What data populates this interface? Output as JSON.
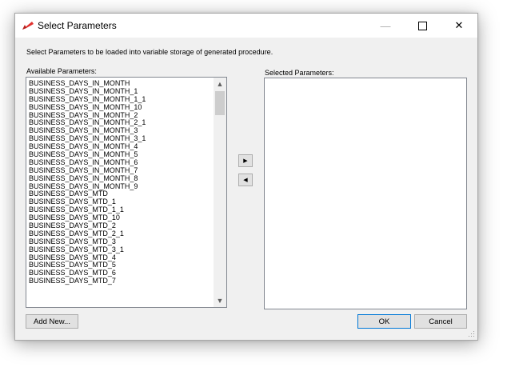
{
  "window": {
    "title": "Select Parameters",
    "minimize_glyph": "—",
    "close_glyph": "✕"
  },
  "instruction": "Select Parameters to be loaded into variable storage of generated procedure.",
  "available": {
    "label": "Available Parameters:",
    "items": [
      "BUSINESS_DAYS_IN_MONTH",
      "BUSINESS_DAYS_IN_MONTH_1",
      "BUSINESS_DAYS_IN_MONTH_1_1",
      "BUSINESS_DAYS_IN_MONTH_10",
      "BUSINESS_DAYS_IN_MONTH_2",
      "BUSINESS_DAYS_IN_MONTH_2_1",
      "BUSINESS_DAYS_IN_MONTH_3",
      "BUSINESS_DAYS_IN_MONTH_3_1",
      "BUSINESS_DAYS_IN_MONTH_4",
      "BUSINESS_DAYS_IN_MONTH_5",
      "BUSINESS_DAYS_IN_MONTH_6",
      "BUSINESS_DAYS_IN_MONTH_7",
      "BUSINESS_DAYS_IN_MONTH_8",
      "BUSINESS_DAYS_IN_MONTH_9",
      "BUSINESS_DAYS_MTD",
      "BUSINESS_DAYS_MTD_1",
      "BUSINESS_DAYS_MTD_1_1",
      "BUSINESS_DAYS_MTD_10",
      "BUSINESS_DAYS_MTD_2",
      "BUSINESS_DAYS_MTD_2_1",
      "BUSINESS_DAYS_MTD_3",
      "BUSINESS_DAYS_MTD_3_1",
      "BUSINESS_DAYS_MTD_4",
      "BUSINESS_DAYS_MTD_5",
      "BUSINESS_DAYS_MTD_6",
      "BUSINESS_DAYS_MTD_7"
    ],
    "scroll_up_glyph": "▲",
    "scroll_down_glyph": "▼"
  },
  "selected": {
    "label": "Selected Parameters:",
    "items": []
  },
  "move_buttons": {
    "add_glyph": "▶",
    "remove_glyph": "◀"
  },
  "buttons": {
    "add_new": "Add New...",
    "ok": "OK",
    "cancel": "Cancel"
  },
  "colors": {
    "app_icon": "#e0302e",
    "focus_border": "#0078d7"
  },
  "icons": {
    "app": "red-arrow-icon",
    "minimize": "minimize-icon",
    "maximize": "maximize-icon",
    "close": "close-icon"
  }
}
